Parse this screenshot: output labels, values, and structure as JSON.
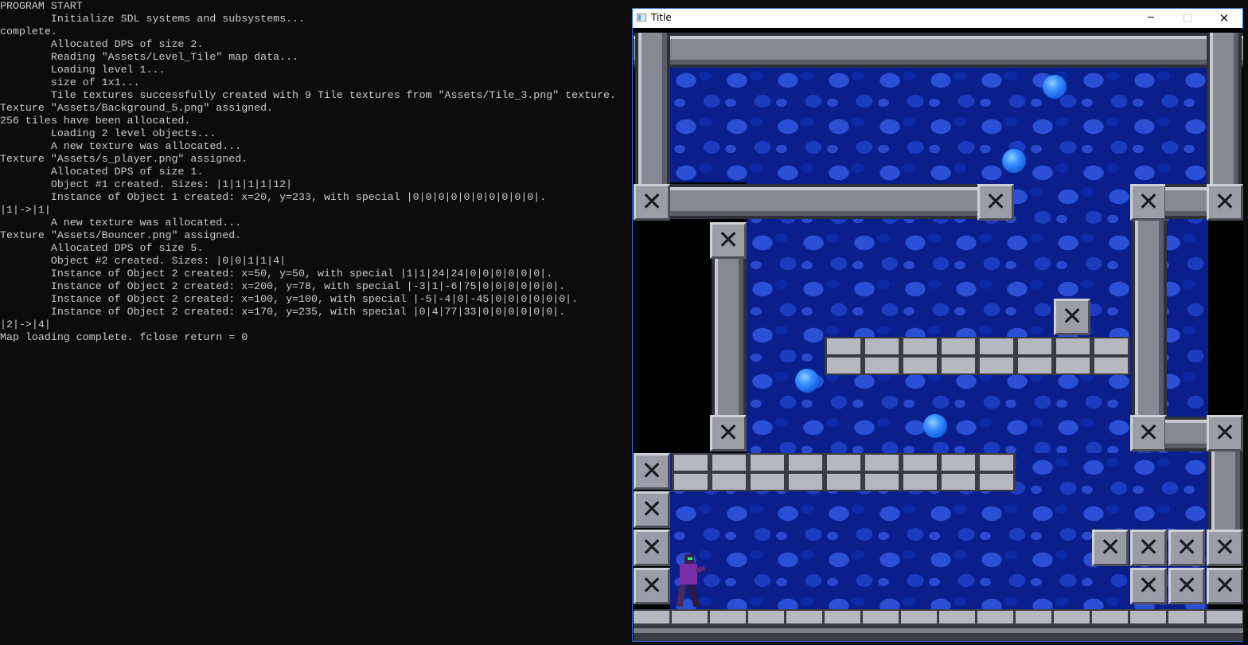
{
  "console": {
    "lines": [
      "PROGRAM START",
      "        Initialize SDL systems and subsystems...",
      "complete.",
      "        Allocated DPS of size 2.",
      "        Reading \"Assets/Level_Tile\" map data...",
      "        Loading level 1...",
      "        size of 1x1...",
      "        Tile textures successfully created with 9 Tile textures from \"Assets/Tile_3.png\" texture.",
      "Texture \"Assets/Background_5.png\" assigned.",
      "256 tiles have been allocated.",
      "        Loading 2 level objects...",
      "        A new texture was allocated...",
      "Texture \"Assets/s_player.png\" assigned.",
      "        Allocated DPS of size 1.",
      "        Object #1 created. Sizes: |1|1|1|1|12|",
      "        Instance of Object 1 created: x=20, y=233, with special |0|0|0|0|0|0|0|0|0|0|.",
      "|1|->|1|",
      "        A new texture was allocated...",
      "Texture \"Assets/Bouncer.png\" assigned.",
      "        Allocated DPS of size 5.",
      "        Object #2 created. Sizes: |0|0|1|1|4|",
      "        Instance of Object 2 created: x=50, y=50, with special |1|1|24|24|0|0|0|0|0|0|.",
      "        Instance of Object 2 created: x=200, y=78, with special |-3|1|-6|75|0|0|0|0|0|0|.",
      "        Instance of Object 2 created: x=100, y=100, with special |-5|-4|0|-45|0|0|0|0|0|0|.",
      "        Instance of Object 2 created: x=170, y=235, with special |0|4|77|33|0|0|0|0|0|0|.",
      "|2|->|4|",
      "Map loading complete. fclose return = 0"
    ]
  },
  "window": {
    "title": "Title",
    "minimize_glyph": "─",
    "maximize_glyph": "□",
    "close_glyph": "✕",
    "block_glyph": "✕"
  }
}
